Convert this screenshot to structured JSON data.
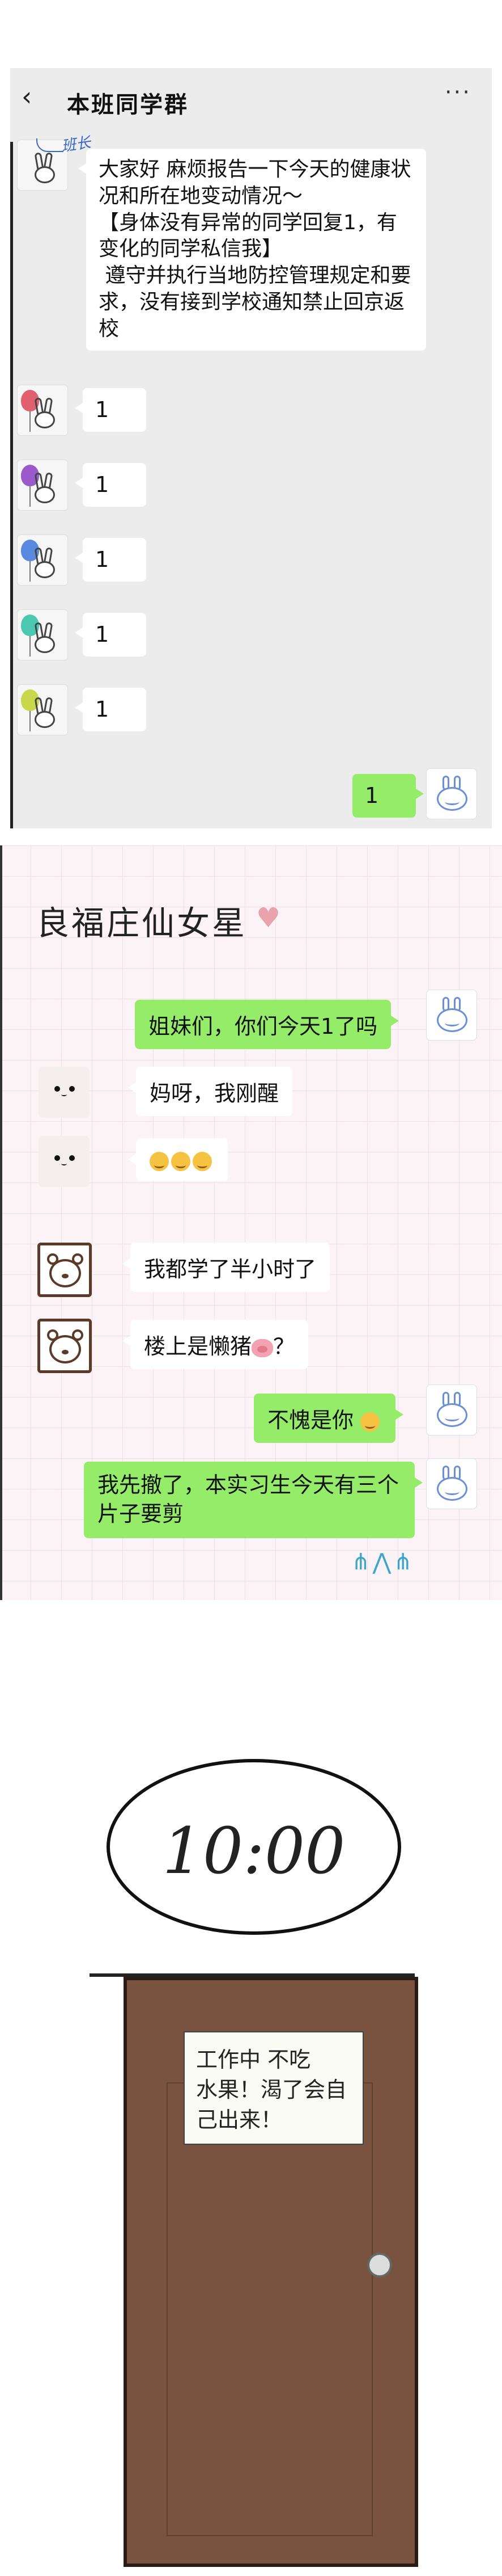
{
  "chat1": {
    "title": "本班同学群",
    "back": "‹",
    "more": "···",
    "monitor_tag": "班长",
    "announcement": "大家好 麻烦报告一下今天的健康状况和所在地变动情况～\n【身体没有异常的同学回复1，有变化的同学私信我】\n 遵守并执行当地防控管理规定和要求，没有接到学校通知禁止回京返校",
    "replies": [
      {
        "text": "1",
        "balloon_color": "#e06070"
      },
      {
        "text": "1",
        "balloon_color": "#9a5ac9"
      },
      {
        "text": "1",
        "balloon_color": "#5a8ae0"
      },
      {
        "text": "1",
        "balloon_color": "#4ac9b0"
      },
      {
        "text": "1",
        "balloon_color": "#c9d84a"
      }
    ],
    "my_reply": "1"
  },
  "chat2": {
    "title": "良福庄仙女星",
    "heart": "♥",
    "messages": [
      {
        "side": "right",
        "text": "姐妹们，你们今天1了吗"
      },
      {
        "side": "left",
        "avatar": "dots",
        "text": "妈呀，我刚醒"
      },
      {
        "side": "left",
        "avatar": "dots",
        "text": "",
        "emoji_count": 3
      },
      {
        "side": "left",
        "avatar": "bear",
        "text": "我都学了半小时了"
      },
      {
        "side": "left",
        "avatar": "bear",
        "text": "楼上是懒猪",
        "suffix": "？"
      },
      {
        "side": "right",
        "text": "不愧是你"
      },
      {
        "side": "right",
        "text": "我先撤了，本实习生今天有三个片子要剪"
      }
    ],
    "doodle": "⋔⋀⋔"
  },
  "clock": {
    "time": "10:00"
  },
  "door": {
    "note_line1": "工作中 不吃",
    "note_line2": "水果！渴了会自",
    "note_line3": "己出来！"
  }
}
